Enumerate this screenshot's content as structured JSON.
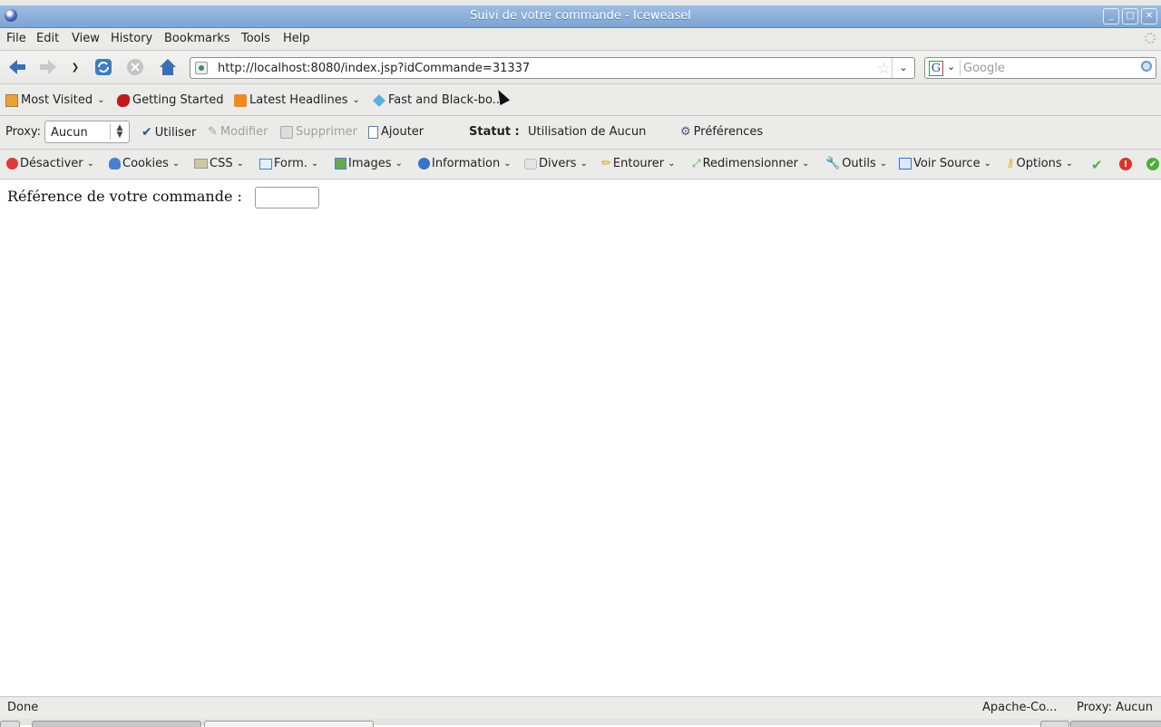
{
  "window": {
    "title": "Suivi de votre commande - Iceweasel",
    "buttons": {
      "minimize": "_",
      "maximize": "□",
      "close": "✕"
    }
  },
  "menubar": {
    "items": [
      "File",
      "Edit",
      "View",
      "History",
      "Bookmarks",
      "Tools",
      "Help"
    ]
  },
  "navigation": {
    "back": "back-icon",
    "forward": "forward-icon",
    "history_dropdown": "chevron-down-icon",
    "reload": "reload-icon",
    "stop": "stop-icon",
    "home": "home-icon",
    "url": "http://localhost:8080/index.jsp?idCommande=31337",
    "search_placeholder": "Google",
    "search_engine": "G"
  },
  "bookmarks": {
    "items": [
      {
        "label": "Most Visited",
        "icon": "folder-icon",
        "dropdown": true
      },
      {
        "label": "Getting Started",
        "icon": "iceweasel-icon",
        "dropdown": false
      },
      {
        "label": "Latest Headlines",
        "icon": "rss-icon",
        "dropdown": true
      },
      {
        "label": "Fast and Black-bo...",
        "icon": "bookmark-icon",
        "dropdown": false
      }
    ]
  },
  "proxy_toolbar": {
    "proxy_label": "Proxy:",
    "proxy_value": "Aucun",
    "use_label": "Utiliser",
    "modify_label": "Modifier",
    "delete_label": "Supprimer",
    "add_label": "Ajouter",
    "status_label": "Statut :",
    "status_value": "Utilisation de Aucun",
    "preferences_label": "Préférences"
  },
  "webdev_toolbar": {
    "items": [
      {
        "label": "Désactiver",
        "icon": "disable-icon"
      },
      {
        "label": "Cookies",
        "icon": "cookie-icon"
      },
      {
        "label": "CSS",
        "icon": "css-icon"
      },
      {
        "label": "Form.",
        "icon": "form-icon"
      },
      {
        "label": "Images",
        "icon": "image-icon"
      },
      {
        "label": "Information",
        "icon": "info-icon"
      },
      {
        "label": "Divers",
        "icon": "misc-icon"
      },
      {
        "label": "Entourer",
        "icon": "outline-icon"
      },
      {
        "label": "Redimensionner",
        "icon": "resize-icon"
      },
      {
        "label": "Outils",
        "icon": "wrench-icon"
      },
      {
        "label": "Voir Source",
        "icon": "view-source-icon"
      },
      {
        "label": "Options",
        "icon": "key-icon"
      }
    ],
    "status_icons": [
      "css-valid-icon",
      "error-icon",
      "valid-icon"
    ],
    "colors": {
      "valid": "#4caf3a",
      "error": "#d9342b"
    }
  },
  "page": {
    "reference_label": "Référence de votre commande :",
    "reference_value": ""
  },
  "statusbar": {
    "status": "Done",
    "extension": "Apache-Co...",
    "proxy": "Proxy: Aucun"
  }
}
